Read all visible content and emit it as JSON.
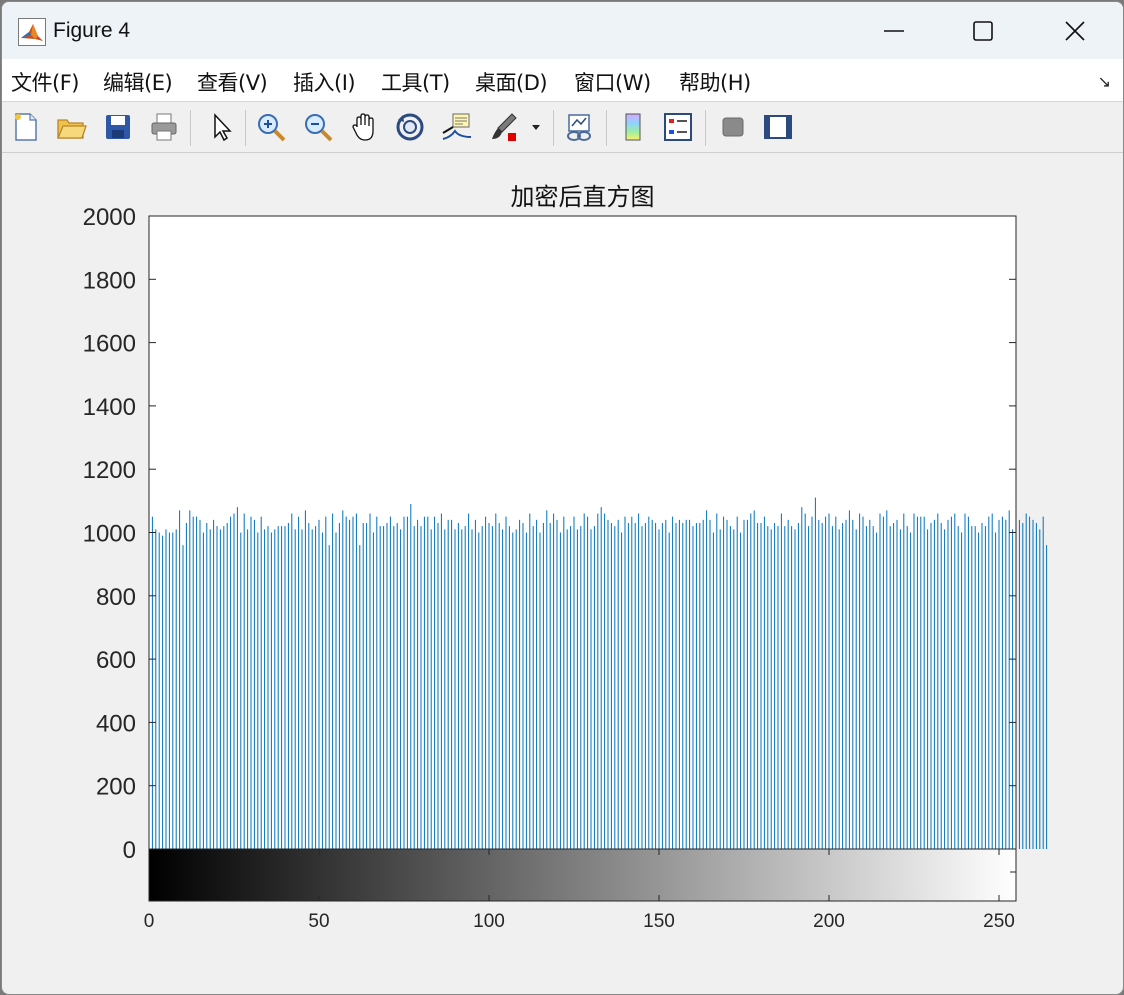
{
  "window": {
    "title": "Figure 4"
  },
  "menu": {
    "items": [
      "文件(F)",
      "编辑(E)",
      "查看(V)",
      "插入(I)",
      "工具(T)",
      "桌面(D)",
      "窗口(W)",
      "帮助(H)"
    ],
    "dock_arrow": "↘"
  },
  "toolbar": {
    "icons": [
      "new-figure-icon",
      "open-file-icon",
      "save-icon",
      "print-icon",
      "select-arrow-icon",
      "zoom-in-icon",
      "zoom-out-icon",
      "pan-hand-icon",
      "rotate-3d-icon",
      "data-cursor-icon",
      "brush-icon",
      "link-plot-icon",
      "colorbar-icon",
      "legend-icon",
      "hide-plot-tools-icon",
      "show-plot-tools-icon"
    ]
  },
  "colors": {
    "bar": "#0072BD",
    "axes_bg": "#ffffff",
    "figure_bg": "#f0f0f0"
  },
  "chart_data": {
    "type": "bar",
    "title": "加密后直方图",
    "xlabel": "",
    "ylabel": "",
    "xlim": [
      0,
      255
    ],
    "ylim": [
      0,
      2000
    ],
    "yticks": [
      0,
      200,
      400,
      600,
      800,
      1000,
      1200,
      1400,
      1600,
      1800,
      2000
    ],
    "xticks": [
      0,
      50,
      100,
      150,
      200,
      250
    ],
    "colorbar": {
      "type": "grayscale",
      "range": [
        0,
        255
      ],
      "position": "below-x-axis"
    },
    "grid": false,
    "x_start": 0,
    "values": [
      1070,
      1050,
      1010,
      1000,
      990,
      1010,
      1000,
      1000,
      1010,
      1070,
      960,
      1030,
      1070,
      1050,
      1050,
      1040,
      1000,
      1030,
      1010,
      1040,
      1020,
      1010,
      1020,
      1030,
      1050,
      1060,
      1080,
      1000,
      1060,
      1010,
      1050,
      1040,
      1000,
      1050,
      1010,
      1020,
      1000,
      1010,
      1020,
      1020,
      1020,
      1030,
      1060,
      1010,
      1050,
      1010,
      1070,
      1030,
      1010,
      1020,
      1040,
      1000,
      1050,
      960,
      1060,
      1000,
      1030,
      1070,
      1050,
      1040,
      1050,
      1060,
      960,
      1030,
      1030,
      1060,
      1000,
      1050,
      1020,
      1020,
      1030,
      1050,
      1020,
      1030,
      1010,
      1050,
      1050,
      1090,
      1020,
      1040,
      1020,
      1050,
      1050,
      1010,
      1050,
      1030,
      1060,
      1010,
      1040,
      1040,
      1010,
      1030,
      1010,
      1020,
      1060,
      1010,
      1040,
      1000,
      1020,
      1050,
      1030,
      1020,
      1060,
      1030,
      1010,
      1050,
      1020,
      1000,
      1010,
      1040,
      1030,
      1000,
      1060,
      1020,
      1040,
      1000,
      1030,
      1070,
      1030,
      1060,
      1040,
      1000,
      1050,
      1010,
      1020,
      1050,
      1010,
      1020,
      1060,
      1050,
      1010,
      1020,
      1060,
      1080,
      1060,
      1040,
      1030,
      1020,
      1040,
      1000,
      1050,
      1030,
      1050,
      1030,
      1060,
      1020,
      1030,
      1050,
      1040,
      1030,
      1010,
      1030,
      1040,
      1000,
      1050,
      1030,
      1040,
      1030,
      1040,
      1040,
      1020,
      1030,
      1030,
      1040,
      1070,
      1040,
      1000,
      1060,
      1010,
      1050,
      1040,
      1020,
      1010,
      1050,
      1000,
      1040,
      1040,
      1060,
      1070,
      1030,
      1030,
      1050,
      1020,
      1010,
      1030,
      1020,
      1060,
      1020,
      1040,
      1020,
      1010,
      1030,
      1080,
      1060,
      1020,
      1050,
      1110,
      1040,
      1030,
      1050,
      1060,
      1020,
      1050,
      1010,
      1030,
      1040,
      1070,
      1040,
      1010,
      1060,
      1050,
      1020,
      1040,
      1020,
      1000,
      1060,
      1050,
      1070,
      1020,
      1030,
      1040,
      1010,
      1060,
      1020,
      1000,
      1060,
      1050,
      1050,
      1050,
      1010,
      1030,
      1040,
      1060,
      1030,
      1010,
      1040,
      1050,
      1060,
      1020,
      1000,
      1060,
      1050,
      1020,
      1020,
      1000,
      1030,
      1020,
      1050,
      1060,
      1000,
      1040,
      1050,
      1040,
      1070,
      1010,
      1000,
      1040,
      1030,
      1060,
      1050,
      1040,
      1030,
      1010,
      1050,
      960
    ]
  }
}
